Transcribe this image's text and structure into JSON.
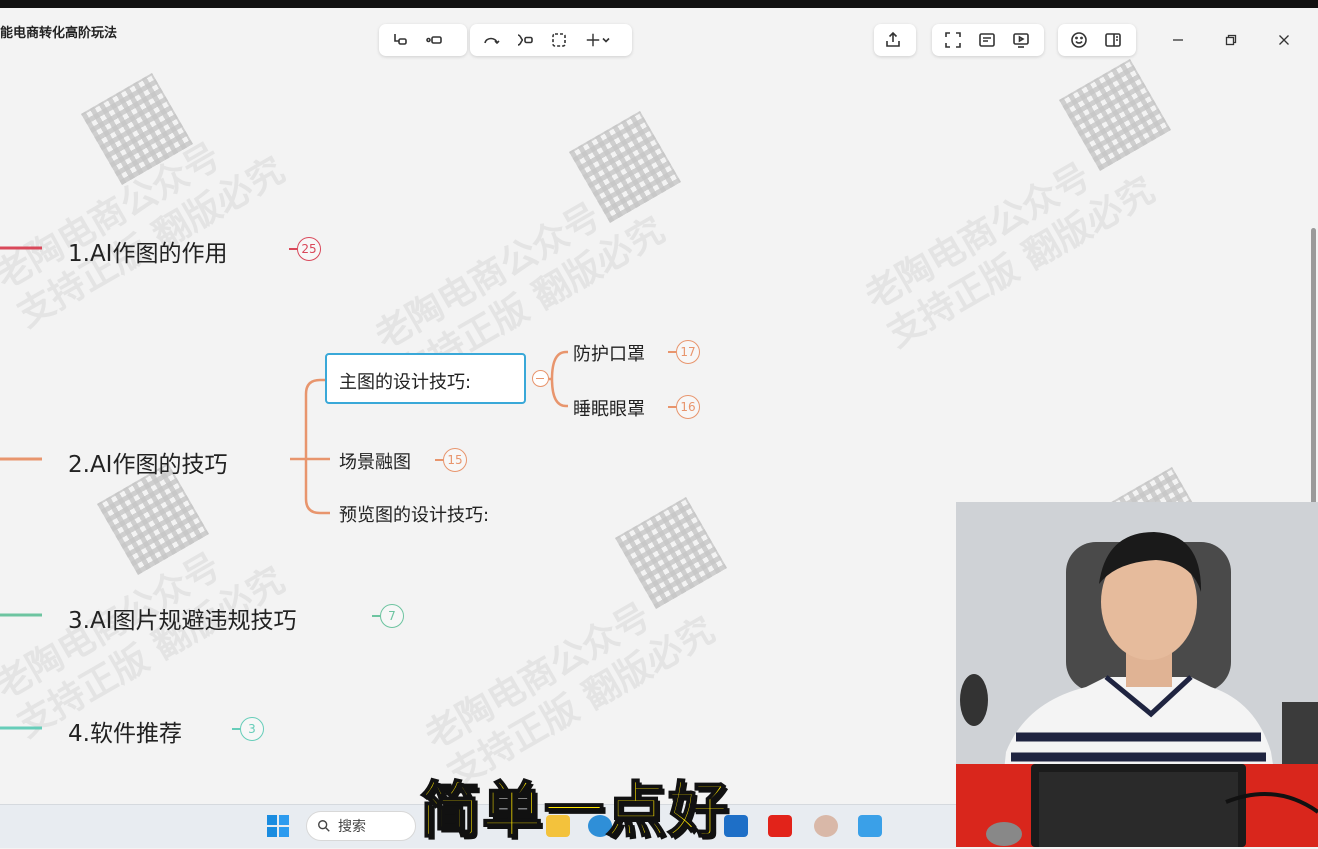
{
  "app": {
    "title": "能电商转化高阶玩法"
  },
  "toolbar": {
    "groups": [
      [
        "insert-child-icon",
        "insert-sibling-icon"
      ],
      [
        "relationship-icon",
        "summary-icon",
        "boundary-icon",
        "add-icon"
      ],
      [
        "share-icon"
      ],
      [
        "fit-screen-icon",
        "outline-icon",
        "present-icon"
      ],
      [
        "emoji-icon",
        "panel-icon"
      ]
    ]
  },
  "window": {
    "controls": [
      "minimize-icon",
      "restore-icon",
      "close-icon"
    ]
  },
  "watermark": {
    "line1": "老陶电商公众号",
    "line2": "支持正版 翻版必究"
  },
  "mindmap": {
    "topics": [
      {
        "label": "1.AI作图的作用",
        "count": "25",
        "color": "#d9485a"
      },
      {
        "label": "2.AI作图的技巧",
        "count": "",
        "color": "#e8956d"
      },
      {
        "label": "3.AI图片规避违规技巧",
        "count": "7",
        "color": "#6dc4a0"
      },
      {
        "label": "4.软件推荐",
        "count": "3",
        "color": "#66cdb9"
      }
    ],
    "subtopics": [
      {
        "label": "主图的设计技巧:",
        "selected": true
      },
      {
        "label": "场景融图",
        "count": "15"
      },
      {
        "label": "预览图的设计技巧:"
      }
    ],
    "leaves": [
      {
        "label": "防护口罩",
        "count": "17"
      },
      {
        "label": "睡眠眼罩",
        "count": "16"
      }
    ]
  },
  "taskbar": {
    "search_label": "搜索",
    "apps": [
      "file-explorer-icon",
      "edge-icon",
      "mail-icon",
      "app-red-icon",
      "avatar-app-icon",
      "photos-icon"
    ]
  },
  "caption": {
    "text": "简单一点好"
  },
  "colors": {
    "accent_selected": "#39a8d8",
    "caption": "#ffe600"
  }
}
